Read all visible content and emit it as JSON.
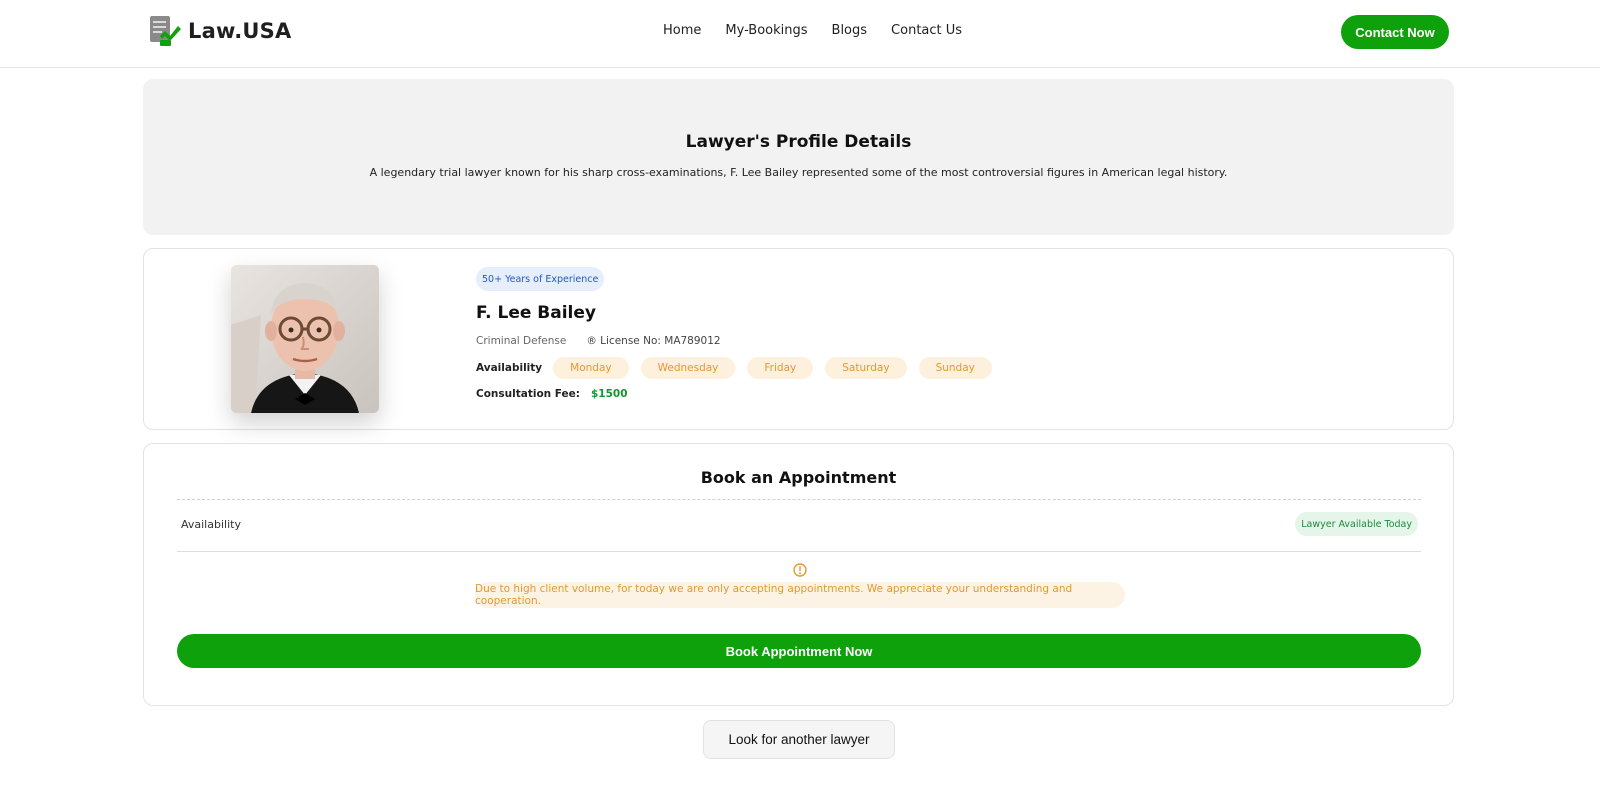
{
  "brand": {
    "name": "Law.USA",
    "accent": "#0ea10b"
  },
  "nav": {
    "items": [
      {
        "label": "Home"
      },
      {
        "label": "My-Bookings"
      },
      {
        "label": "Blogs"
      },
      {
        "label": "Contact Us"
      }
    ],
    "cta_label": "Contact Now"
  },
  "hero": {
    "title": "Lawyer's Profile Details",
    "description": "A legendary trial lawyer known for his sharp cross-examinations, F. Lee Bailey represented some of the most controversial figures in American legal history."
  },
  "profile": {
    "experience_badge": "50+ Years of Experience",
    "name": "F. Lee Bailey",
    "specialty": "Criminal Defense",
    "license": "® License No: MA789012",
    "availability_label": "Availability",
    "days": [
      "Monday",
      "Wednesday",
      "Friday",
      "Saturday",
      "Sunday"
    ],
    "fee_label": "Consultation Fee:",
    "fee_value": "$1500"
  },
  "booking": {
    "title": "Book an Appointment",
    "availability_label": "Availability",
    "status_badge": "Lawyer Available Today",
    "notice": "Due to high client volume, for today we are only accepting appointments. We appreciate your understanding and cooperation.",
    "button_label": "Book Appointment Now"
  },
  "footer_action": {
    "label": "Look for another lawyer"
  }
}
